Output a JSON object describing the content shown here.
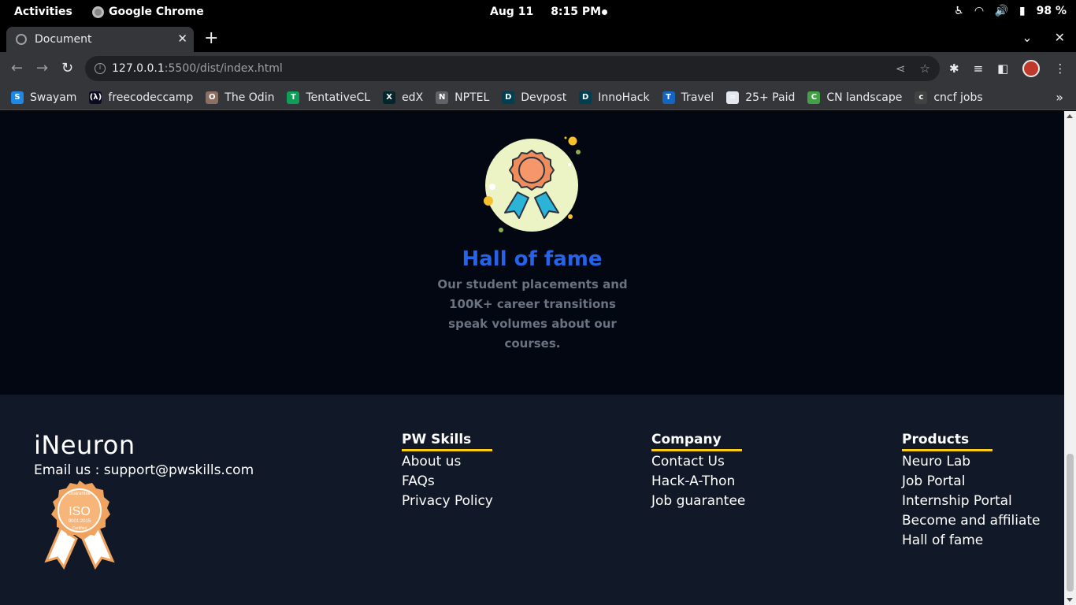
{
  "system_bar": {
    "activities": "Activities",
    "app_name": "Google Chrome",
    "date": "Aug 11",
    "time": "8:15 PM",
    "battery": "98 %"
  },
  "browser": {
    "tab_title": "Document",
    "url_host": "127.0.0.1",
    "url_path": ":5500/dist/index.html",
    "bookmarks": [
      {
        "label": "Swayam",
        "color": "#1e88e5",
        "glyph": "S"
      },
      {
        "label": "freecodeccamp",
        "color": "#0a0a23",
        "glyph": "(λ)"
      },
      {
        "label": "The Odin",
        "color": "#8d6e63",
        "glyph": "O"
      },
      {
        "label": "TentativeCL",
        "color": "#0f9d58",
        "glyph": "T"
      },
      {
        "label": "edX",
        "color": "#02262b",
        "glyph": "X"
      },
      {
        "label": "NPTEL",
        "color": "#5f6368",
        "glyph": "N"
      },
      {
        "label": "Devpost",
        "color": "#003e54",
        "glyph": "D"
      },
      {
        "label": "InnoHack",
        "color": "#003e54",
        "glyph": "D"
      },
      {
        "label": "Travel",
        "color": "#1565c0",
        "glyph": "T"
      },
      {
        "label": "25+ Paid",
        "color": "#e3e7ef",
        "glyph": "="
      },
      {
        "label": "CN landscape",
        "color": "#43a047",
        "glyph": "C"
      },
      {
        "label": "cncf jobs",
        "color": "#424242",
        "glyph": "c"
      }
    ]
  },
  "hall_of_fame": {
    "title": "Hall of fame",
    "description": "Our student placements and 100K+ career transitions speak volumes about our courses.",
    "title_color": "#2563eb"
  },
  "footer": {
    "logo_text": "iNeuron",
    "email": "Email us : support@pwskills.com",
    "iso_badge": {
      "top": "Guarantee",
      "main": "ISO",
      "sub": "9001:2015",
      "bottom": "Certified"
    },
    "columns": [
      {
        "heading": "PW Skills",
        "links": [
          "About us",
          "FAQs",
          "Privacy Policy"
        ]
      },
      {
        "heading": "Company",
        "links": [
          "Contact Us",
          "Hack-A-Thon",
          "Job guarantee"
        ]
      },
      {
        "heading": "Products",
        "links": [
          "Neuro Lab",
          "Job Portal",
          "Internship Portal",
          "Become and affiliate",
          "Hall of fame"
        ]
      }
    ],
    "accent_color": "#facc15"
  }
}
